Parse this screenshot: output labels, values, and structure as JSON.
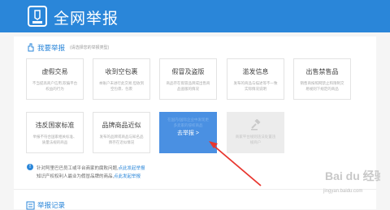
{
  "header": {
    "title": "全网举报"
  },
  "report_section": {
    "title": "我要举报",
    "subtitle": "(请选择您的举报类型)",
    "categories": [
      {
        "label": "虚假交易",
        "desc": "不当提高商户信用,欺骗平台权益的行为"
      },
      {
        "label": "收到空包裹",
        "desc": "本账户未进行此交易,但收到空包裹、包裹"
      },
      {
        "label": "假冒及盗版",
        "desc": "商品存在假冒品牌成出售商品盗版的情况"
      },
      {
        "label": "滥发信息",
        "desc": "发布的商品与描述等不一致实际情况说明"
      },
      {
        "label": "出售禁售品",
        "desc": "销售商按照网禁止和限制交易规则下规定的商品"
      },
      {
        "label": "违反国家标准",
        "desc": "举报不符合国家相关标准、质量法规的商品"
      },
      {
        "label": "品牌商品近似",
        "desc": "发布的品牌或商品与知名品牌存在近似情况"
      }
    ],
    "report_card": {
      "ghost_text": "在国内/国际企业中发现更多卖家的侵权商品",
      "button_label": "去举报 >"
    },
    "disabled_card": {
      "icon": "gavel-icon",
      "desc": "商家平台规则违法处置违规商户"
    }
  },
  "notes": [
    {
      "text": "针对阿里巴巴员工或平台商家的腐败问题,",
      "link": "点此发起举报"
    },
    {
      "text": "知识产权权利人最业为假冒品牌的商品,",
      "link": "点此发起举报"
    }
  ],
  "records_section": {
    "title": "举报记录"
  },
  "watermark": {
    "brand": "Bai du 经验",
    "url": "jingyan.baidu.com"
  },
  "colors": {
    "brand": "#2a86d9",
    "card_active": "#4a90e2",
    "arrow": "#e8352e"
  }
}
